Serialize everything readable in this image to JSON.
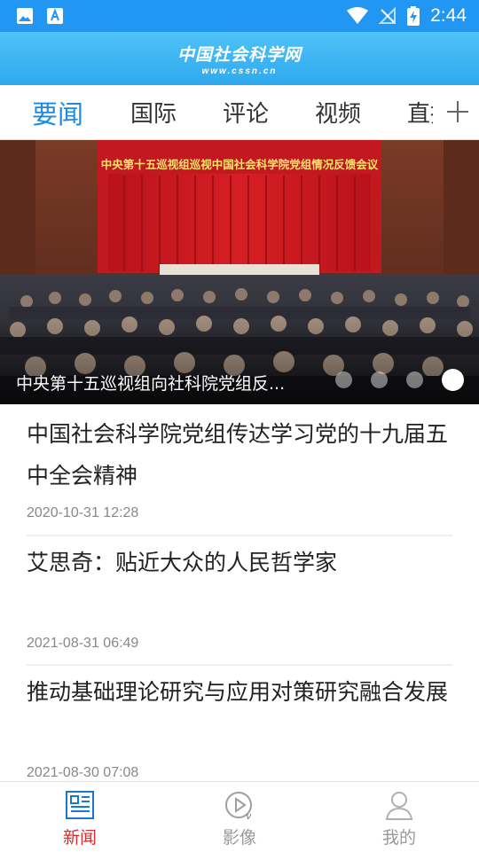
{
  "status_bar": {
    "time": "2:44"
  },
  "header": {
    "logo_cn": "中国社会科学网",
    "logo_en": "www.cssn.cn"
  },
  "tabs": [
    "要闻",
    "国际",
    "评论",
    "视频",
    "直播"
  ],
  "carousel": {
    "banner_text": "中央第十五巡视组巡视中国社会科学院党组情况反馈会议",
    "caption": "中央第十五巡视组向社科院党组反...",
    "dot_count": 4,
    "active_dot": 4
  },
  "articles": [
    {
      "title": "中国社会科学院党组传达学习党的十九届五中全会精神",
      "time": "2020-10-31  12:28"
    },
    {
      "title": "艾思奇：贴近大众的人民哲学家",
      "time": "2021-08-31  06:49"
    },
    {
      "title": "推动基础理论研究与应用对策研究融合发展",
      "time": "2021-08-30  07:08"
    }
  ],
  "bottom_nav": [
    {
      "label": "新闻",
      "icon": "newspaper-icon"
    },
    {
      "label": "影像",
      "icon": "play-video-icon"
    },
    {
      "label": "我的",
      "icon": "user-icon"
    }
  ],
  "colors": {
    "status_bar": "#2196f3",
    "header": "#3aaef2",
    "tab_active": "#1e88e5",
    "nav_active": "#d32f2f"
  }
}
